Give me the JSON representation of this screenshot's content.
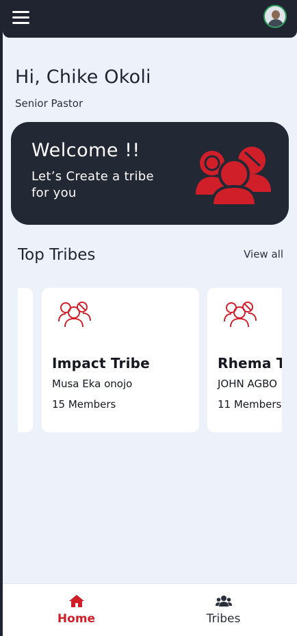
{
  "colors": {
    "dark": "#1f2430",
    "accent": "#d11f2a",
    "background": "#ecf1fa",
    "card": "#ffffff"
  },
  "topbar": {
    "menu_icon": "hamburger-menu-icon",
    "avatar_icon": "user-avatar"
  },
  "greeting": {
    "title": "Hi, Chike Okoli",
    "role": "Senior Pastor"
  },
  "welcome": {
    "title": "Welcome !!",
    "subtitle": "Let’s Create a tribe for you",
    "icon": "tribe-group-icon"
  },
  "top_tribes": {
    "title": "Top Tribes",
    "view_all": "View all",
    "cards": [
      {
        "name": "Impact Tribe",
        "leader": "Musa Eka onojo",
        "members": "15 Members",
        "icon": "tribe-group-icon"
      },
      {
        "name": "Rhema Tribe",
        "leader": "JOHN AGBO",
        "members": "11 Members",
        "icon": "tribe-group-icon"
      }
    ]
  },
  "bottom_nav": {
    "home": {
      "label": "Home",
      "icon": "home-icon",
      "active": true
    },
    "tribes": {
      "label": "Tribes",
      "icon": "people-group-icon",
      "active": false
    }
  }
}
